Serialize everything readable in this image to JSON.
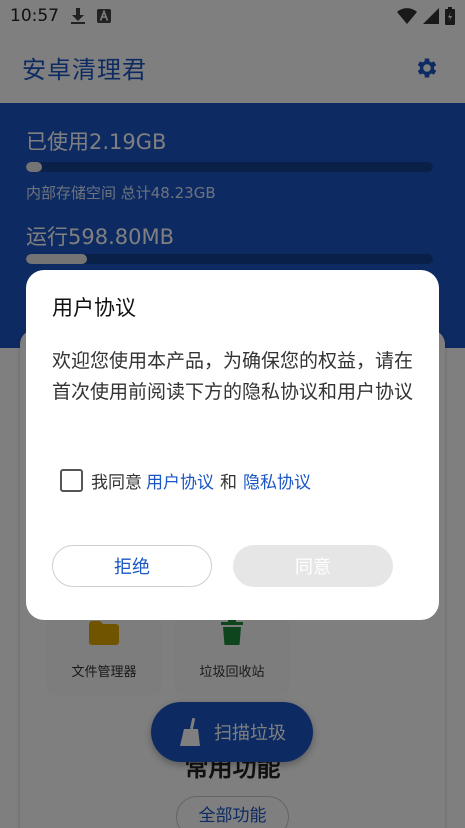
{
  "status_bar": {
    "time": "10:57",
    "icons": [
      "download-icon",
      "text-a-icon",
      "wifi-icon",
      "signal-icon",
      "battery-icon"
    ]
  },
  "app_bar": {
    "title": "安卓清理君",
    "settings_icon": "gear-icon"
  },
  "header": {
    "storage_used_label": "已使用2.19GB",
    "storage_progress": 0.04,
    "storage_caption": "内部存储空间 总计48.23GB",
    "ram_used_label": "运行598.80MB",
    "ram_progress": 0.15
  },
  "tools": [
    {
      "label": "文件管理器",
      "icon": "folder-icon"
    },
    {
      "label": "垃圾回收站",
      "icon": "trash-icon"
    }
  ],
  "scan_button": {
    "label": "扫描垃圾",
    "icon": "broom-icon"
  },
  "common_section": {
    "title": "常用功能",
    "all_button": "全部功能"
  },
  "dialog": {
    "title": "用户协议",
    "message": "欢迎您使用本产品，为确保您的权益，请在首次使用前阅读下方的隐私协议和用户协议",
    "consent_prefix": "我同意",
    "user_agreement_link": "用户协议",
    "consent_and": "和",
    "privacy_link": "隐私协议",
    "reject_label": "拒绝",
    "agree_label": "同意"
  },
  "colors": {
    "primary": "#1a56c4",
    "folder": "#e0a800",
    "trash": "#1f8a3a"
  }
}
